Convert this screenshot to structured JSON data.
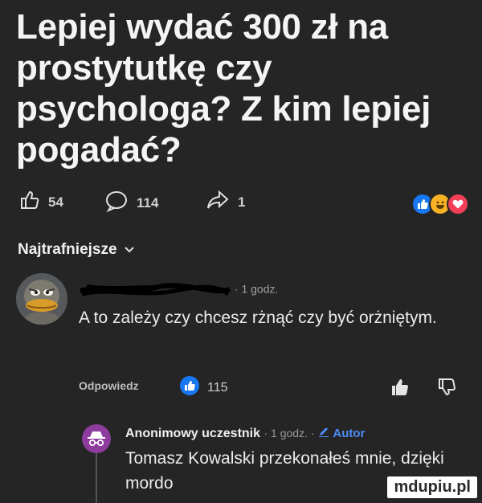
{
  "post": {
    "title": "Lepiej wydać 300 zł na prostytutkę czy psychologa? Z kim lepiej pogadać?"
  },
  "stats": {
    "likes": "54",
    "comments": "114",
    "shares": "1",
    "icons": [
      "thumb-up-icon",
      "chat-bubble-icon",
      "share-arrow-icon"
    ]
  },
  "reactions": {
    "icons": [
      "like-reaction-icon",
      "haha-reaction-icon",
      "love-reaction-icon"
    ],
    "colors": [
      "#1877f2",
      "#f7b125",
      "#f33e58"
    ]
  },
  "sort": {
    "label": "Najtrafniejsze"
  },
  "comment": {
    "time": "· 1 godz.",
    "text": "A to zależy czy chcesz rżnąć czy być orżniętym.",
    "reply_label": "Odpowiedz",
    "like_count": "115"
  },
  "reply": {
    "author": "Anonimowy uczestnik",
    "time": "· 1 godz. ·",
    "author_badge": "Autor",
    "text": "Tomasz Kowalski przekonałeś mnie, dzięki mordo"
  },
  "watermark": "mdupiu.pl",
  "colors": {
    "background": "#252526",
    "accent": "#4d8df6",
    "anon_avatar": "#8e3b9e"
  }
}
